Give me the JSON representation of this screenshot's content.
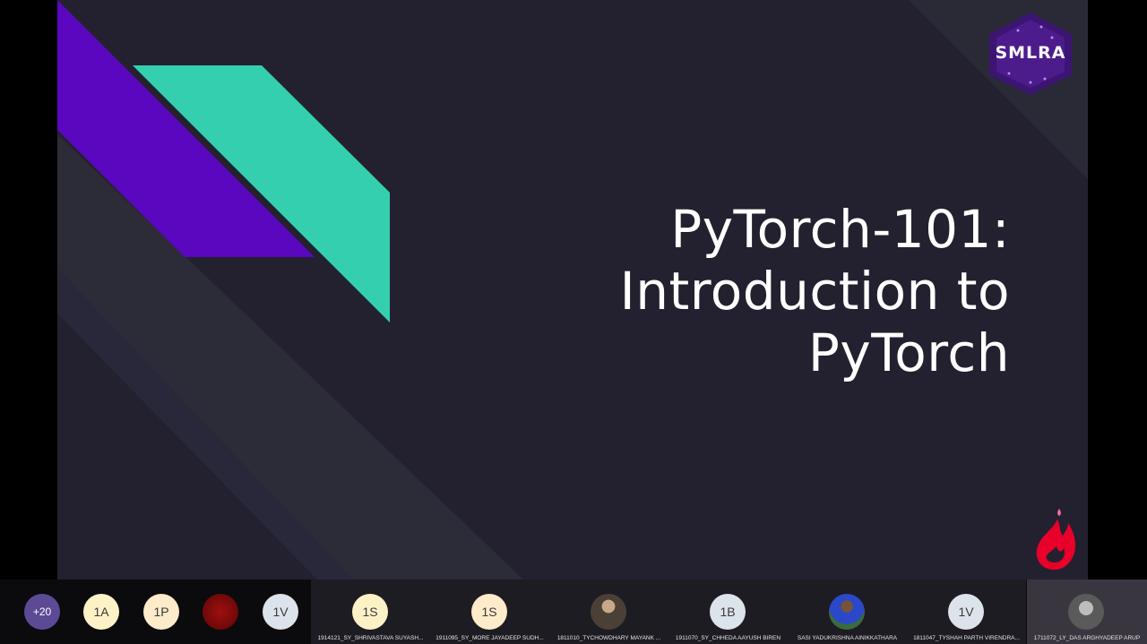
{
  "slide": {
    "title_lines": [
      "PyTorch-101:",
      "Introduction to",
      "PyTorch"
    ],
    "logo_text": "SMLRA",
    "colors": {
      "background": "#23212f",
      "purple": "#5b06bf",
      "teal": "#34cfae",
      "flame": "#e8002a"
    }
  },
  "participants": {
    "more_count": "+20",
    "small": [
      {
        "initials": "1A",
        "color": "#fdf2c6"
      },
      {
        "initials": "1P",
        "color": "#fdebc9"
      },
      {
        "initials": "",
        "color": "#8a0a0a"
      },
      {
        "initials": "1V",
        "color": "#dde3ea"
      }
    ],
    "named": [
      {
        "initials": "1S",
        "name": "1914121_SY_SHRIVASTAVA  SUYASH...",
        "color": "#fdf2c6"
      },
      {
        "initials": "1S",
        "name": "1911095_SY_MORE  JAYADEEP SUDH...",
        "color": "#fdebc9"
      },
      {
        "initials": "",
        "name": "1811010_TYCHOWDHARY  MAYANK ...",
        "color": "#4b4036",
        "photo": true
      },
      {
        "initials": "1B",
        "name": "1911070_SY_CHHEDA AAYUSH BIREN",
        "color": "#dde3ea"
      },
      {
        "initials": "",
        "name": "SASI YADUKRISHNA AINIKKATHARA",
        "color": "#3b6b3a",
        "photo": true
      },
      {
        "initials": "1V",
        "name": "1811047_TYSHAH  PARTH VIRENDRA...",
        "color": "#dde3ea"
      },
      {
        "initials": "",
        "name": "1711072_LY_DAS ARGHYADEEP ARUP",
        "color": "#5a5a5a",
        "photo": true
      }
    ]
  }
}
